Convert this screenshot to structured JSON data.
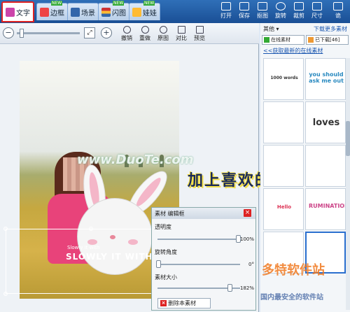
{
  "tabs": [
    {
      "label": "文字"
    },
    {
      "label": "边框"
    },
    {
      "label": "场景"
    },
    {
      "label": "闪图"
    },
    {
      "label": "娃娃"
    }
  ],
  "right_tools": [
    "打开",
    "保存",
    "抠图",
    "旋转",
    "裁剪",
    "尺寸",
    "诡"
  ],
  "edit_tools": [
    "撤销",
    "重做",
    "原图",
    "对比",
    "预览"
  ],
  "zoom": {
    "minus": "−",
    "plus": "+"
  },
  "photo": {
    "overlay_text": "SLOWLY IT WITH",
    "overlay_small": "Slowly it with"
  },
  "watermark": "www.DuoTe.com",
  "caption": "加上喜欢的文字",
  "panel": {
    "title": "素材 编辑框",
    "close": "×",
    "opacity_label": "透明度",
    "opacity_value": "100%",
    "rotation_label": "旋转角度",
    "rotation_value": "0°",
    "size_label": "素材大小",
    "size_value": "182%",
    "delete_label": "删除本素材"
  },
  "sidebar": {
    "category": "其他",
    "download_more": "下载更多素材",
    "tab_online": "在线素材",
    "tab_downloaded": "已下载[46]",
    "get_latest": "<<获取最新的在线素材",
    "thumb_texts": [
      "1000 words",
      "you should ask me out",
      "",
      "loves",
      "",
      "",
      "Hello",
      "RUMINATION",
      "",
      ""
    ]
  },
  "site_watermark": "多特软件站",
  "site_sub": "国内最安全的软件站",
  "colors": {
    "accent": "#2a6fcf",
    "toolbar": "#1a4f95",
    "close_red": "#dd2222"
  }
}
